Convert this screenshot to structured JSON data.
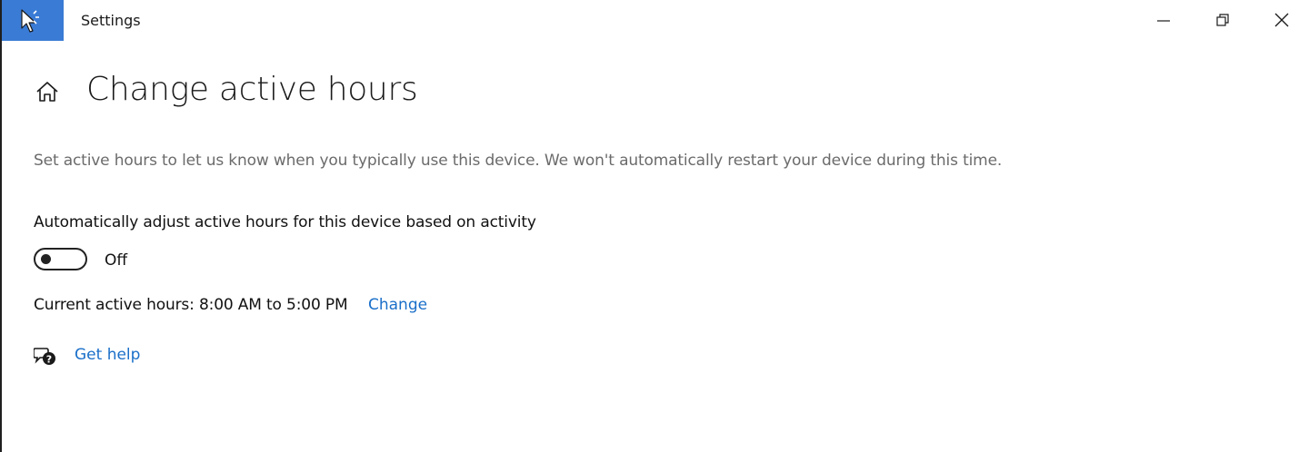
{
  "window": {
    "title": "Settings",
    "accent_color": "#3a7bd5",
    "controls": {
      "minimize_icon": "minimize-icon",
      "restore_icon": "restore-icon",
      "close_icon": "close-icon"
    }
  },
  "page": {
    "home_icon": "home-icon",
    "title": "Change active hours",
    "description": "Set active hours to let us know when you typically use this device. We won't automatically restart your device during this time.",
    "auto_adjust": {
      "label": "Automatically adjust active hours for this device based on activity",
      "enabled": false,
      "state_text": "Off"
    },
    "current_hours": {
      "text": "Current active hours: 8:00 AM to 5:00 PM",
      "change_link": "Change",
      "link_color": "#1a6fc9"
    },
    "help": {
      "icon": "get-help-icon",
      "label": "Get help"
    }
  }
}
